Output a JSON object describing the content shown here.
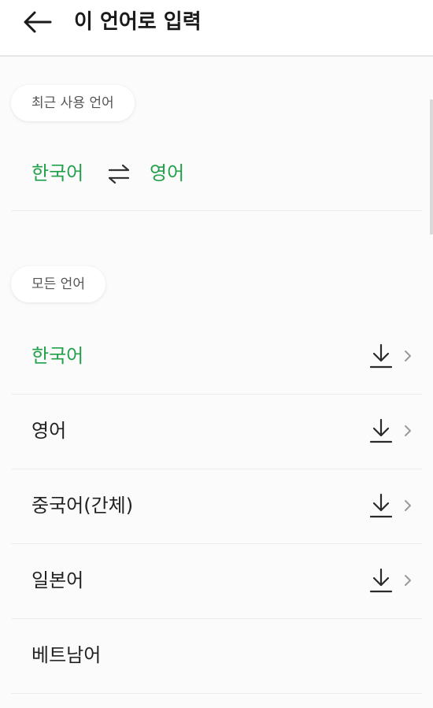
{
  "header": {
    "back_icon": "arrow-left-icon",
    "title": "이 언어로 입력"
  },
  "recent": {
    "section_label": "최근 사용 언어",
    "source": "한국어",
    "swap_icon": "swap-arrows-icon",
    "target": "영어"
  },
  "all": {
    "section_label": "모든 언어",
    "languages": [
      {
        "label": "한국어",
        "active": true,
        "download_icon": "download-icon",
        "chevron_icon": "chevron-right-icon"
      },
      {
        "label": "영어",
        "active": false,
        "download_icon": "download-icon",
        "chevron_icon": "chevron-right-icon"
      },
      {
        "label": "중국어(간체)",
        "active": false,
        "download_icon": "download-icon",
        "chevron_icon": "chevron-right-icon"
      },
      {
        "label": "일본어",
        "active": false,
        "download_icon": "download-icon",
        "chevron_icon": "chevron-right-icon"
      },
      {
        "label": "베트남어",
        "active": false
      }
    ]
  },
  "colors": {
    "accent_green": "#22a04b",
    "text": "#222222",
    "divider": "#ececec"
  }
}
